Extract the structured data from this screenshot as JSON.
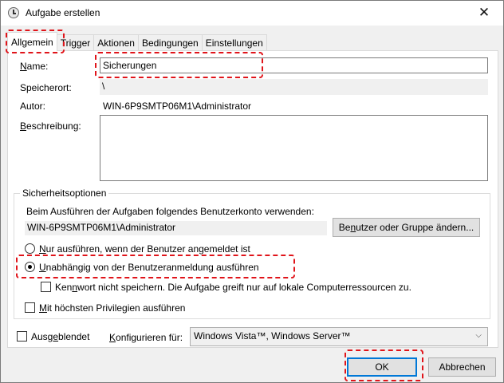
{
  "window": {
    "title": "Aufgabe erstellen",
    "close_symbol": "✕"
  },
  "tabs": [
    {
      "label": "Allgemein",
      "active": true
    },
    {
      "label": "Trigger",
      "active": false
    },
    {
      "label": "Aktionen",
      "active": false
    },
    {
      "label": "Bedingungen",
      "active": false
    },
    {
      "label": "Einstellungen",
      "active": false
    }
  ],
  "general": {
    "name_label_u": "N",
    "name_label_rest": "ame:",
    "name_value": "Sicherungen",
    "location_label": "Speicherort:",
    "location_value": "\\",
    "author_label": "Autor:",
    "author_value": "WIN-6P9SMTP06M1\\Administrator",
    "description_label_u": "B",
    "description_label_rest": "eschreibung:",
    "description_value": ""
  },
  "security": {
    "group_title": "Sicherheitsoptionen",
    "account_prompt": "Beim Ausführen der Aufgaben folgendes Benutzerkonto verwenden:",
    "account_value": "WIN-6P9SMTP06M1\\Administrator",
    "change_user_pre": "Be",
    "change_user_u": "n",
    "change_user_post": "utzer oder Gruppe ändern...",
    "radio_logged_on_u": "N",
    "radio_logged_on_rest": "ur ausführen, wenn der Benutzer angemeldet ist",
    "radio_logged_on_checked": false,
    "radio_independent_u": "U",
    "radio_independent_rest": "nabhängig von der Benutzeranmeldung ausführen",
    "radio_independent_checked": true,
    "no_store_password_pre": "Ken",
    "no_store_password_u": "n",
    "no_store_password_post": "wort nicht speichern. Die Aufgabe greift nur auf lokale Computerressourcen zu.",
    "no_store_password_checked": false,
    "highest_priv_u": "M",
    "highest_priv_rest": "it höchsten Privilegien ausführen",
    "highest_priv_checked": false
  },
  "bottom": {
    "hidden_pre": "Ausg",
    "hidden_u": "e",
    "hidden_post": "blendet",
    "hidden_checked": false,
    "configure_u": "K",
    "configure_rest": "onfigurieren für:",
    "configure_value": "Windows Vista™, Windows Server™",
    "ok_label": "OK",
    "cancel_label": "Abbrechen"
  },
  "colors": {
    "highlight": "#e0141a",
    "default_button_border": "#0078d7"
  }
}
